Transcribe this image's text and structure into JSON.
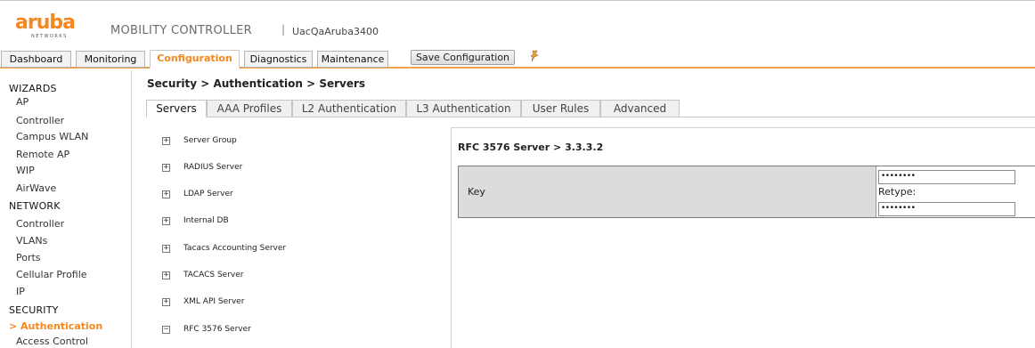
{
  "header": {
    "logo_text": "aruba",
    "logo_sub": "NETWORKS",
    "product": "MOBILITY CONTROLLER",
    "separator": "|",
    "hostname": "UacQaAruba3400"
  },
  "nav": {
    "tabs": [
      {
        "label": "Dashboard"
      },
      {
        "label": "Monitoring"
      },
      {
        "label": "Configuration"
      },
      {
        "label": "Diagnostics"
      },
      {
        "label": "Maintenance"
      }
    ],
    "active": "Configuration",
    "save_label": "Save Configuration",
    "pin_icon": "pushpin-icon"
  },
  "sidebar": {
    "sections": [
      {
        "label": "WIZARDS"
      },
      {
        "label": "NETWORK"
      },
      {
        "label": "SECURITY"
      }
    ],
    "wizards": [
      {
        "label": "AP"
      },
      {
        "label": "Controller"
      },
      {
        "label": "Campus WLAN"
      },
      {
        "label": "Remote AP"
      },
      {
        "label": "WIP"
      },
      {
        "label": "AirWave"
      }
    ],
    "network": [
      {
        "label": "Controller"
      },
      {
        "label": "VLANs"
      },
      {
        "label": "Ports"
      },
      {
        "label": "Cellular Profile"
      },
      {
        "label": "IP"
      }
    ],
    "security": [
      {
        "label": "> Authentication"
      },
      {
        "label": "Access Control"
      }
    ]
  },
  "main": {
    "breadcrumb": "Security > Authentication > Servers",
    "subtabs": [
      {
        "label": "Servers"
      },
      {
        "label": "AAA Profiles"
      },
      {
        "label": "L2 Authentication"
      },
      {
        "label": "L3 Authentication"
      },
      {
        "label": "User Rules"
      },
      {
        "label": "Advanced"
      }
    ],
    "active_subtab": "Servers",
    "tree": [
      {
        "toggle": "+",
        "label": "Server Group"
      },
      {
        "toggle": "+",
        "label": "RADIUS Server"
      },
      {
        "toggle": "+",
        "label": "LDAP Server"
      },
      {
        "toggle": "+",
        "label": "Internal DB"
      },
      {
        "toggle": "+",
        "label": "Tacacs Accounting Server"
      },
      {
        "toggle": "+",
        "label": "TACACS Server"
      },
      {
        "toggle": "+",
        "label": "XML API Server"
      },
      {
        "toggle": "−",
        "label": "RFC 3576 Server"
      }
    ],
    "panel": {
      "title": "RFC 3576 Server > 3.3.3.2",
      "key_label": "Key",
      "key_value": "••••••••",
      "retype_label": "Retype:",
      "retype_value": "••••••••"
    }
  },
  "colors": {
    "accent": "#f7861d",
    "nav_rule": "#f2a04a",
    "label_bg": "#dcdcdc"
  }
}
